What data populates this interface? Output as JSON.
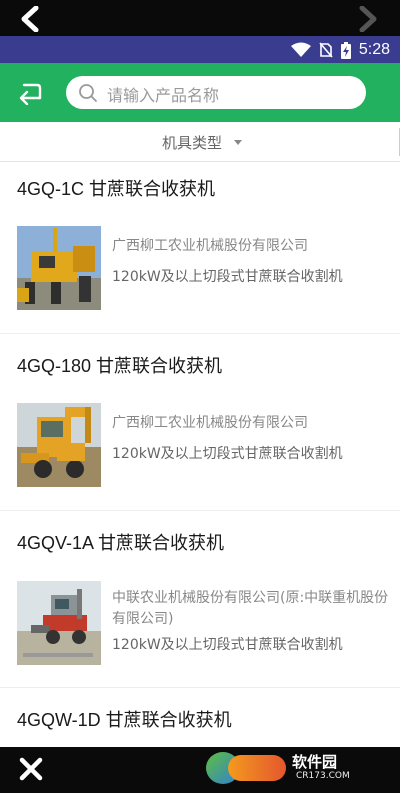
{
  "status": {
    "time": "5:28"
  },
  "search": {
    "placeholder": "请输入产品名称"
  },
  "filter": {
    "label": "机具类型"
  },
  "items": [
    {
      "title": "4GQ-1C 甘蔗联合收获机",
      "maker": "广西柳工农业机械股份有限公司",
      "spec": "120kW及以上切段式甘蔗联合收割机"
    },
    {
      "title": "4GQ-180 甘蔗联合收获机",
      "maker": "广西柳工农业机械股份有限公司",
      "spec": "120kW及以上切段式甘蔗联合收割机"
    },
    {
      "title": "4GQV-1A 甘蔗联合收获机",
      "maker": "中联农业机械股份有限公司(原:中联重机股份有限公司)",
      "spec": "120kW及以上切段式甘蔗联合收割机"
    },
    {
      "title": "4GQW-1D 甘蔗联合收获机",
      "maker": "",
      "spec": ""
    }
  ],
  "watermark": {
    "text": "软件园",
    "sub": "CR173.COM"
  },
  "colors": {
    "accent": "#22b15e",
    "status_bar": "#3a3d8f"
  }
}
